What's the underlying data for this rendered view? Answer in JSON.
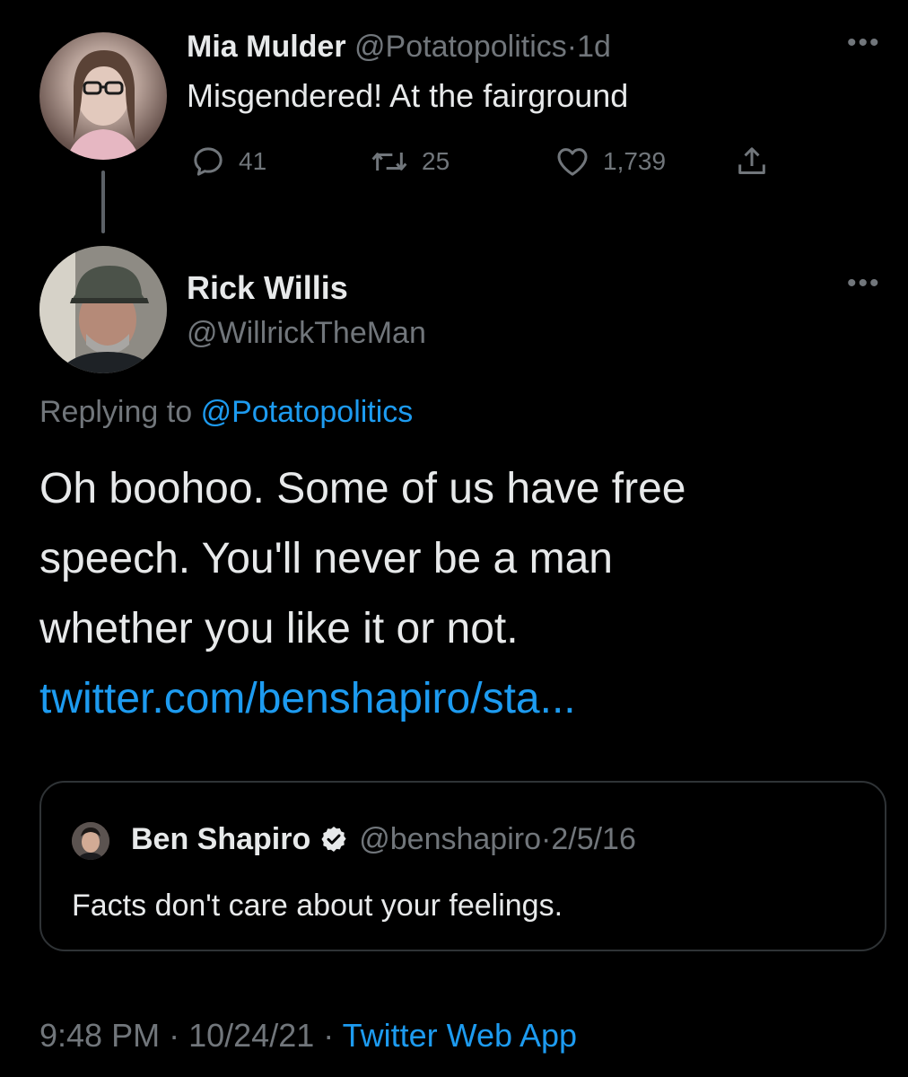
{
  "parent_tweet": {
    "display_name": "Mia Mulder",
    "handle": "@Potatopolitics",
    "separator": "·",
    "time": "1d",
    "text": "Misgendered! At the fairground",
    "more": "•••",
    "replies": "41",
    "retweets": "25",
    "likes": "1,739"
  },
  "reply_tweet": {
    "display_name": "Rick Willis",
    "handle": "@WillrickTheMan",
    "more": "•••",
    "replying_prefix": "Replying to",
    "replying_handle": "@Potatopolitics",
    "text_lines": [
      "Oh boohoo. Some of us have free",
      "speech. You'll never be a man",
      "whether you like it or not."
    ],
    "link": "twitter.com/benshapiro/sta..."
  },
  "quoted_tweet": {
    "display_name": "Ben Shapiro",
    "handle": "@benshapiro",
    "separator": "·",
    "date": "2/5/16",
    "text": "Facts don't care about your feelings."
  },
  "footer": {
    "time": "9:48 PM",
    "separator_1": "·",
    "date": "10/24/21",
    "separator_2": "·",
    "source": "Twitter Web App"
  },
  "colors": {
    "background": "#000000",
    "text": "#e7e9ea",
    "muted": "#71767b",
    "link": "#1d9bf0",
    "border": "#2f3336"
  }
}
